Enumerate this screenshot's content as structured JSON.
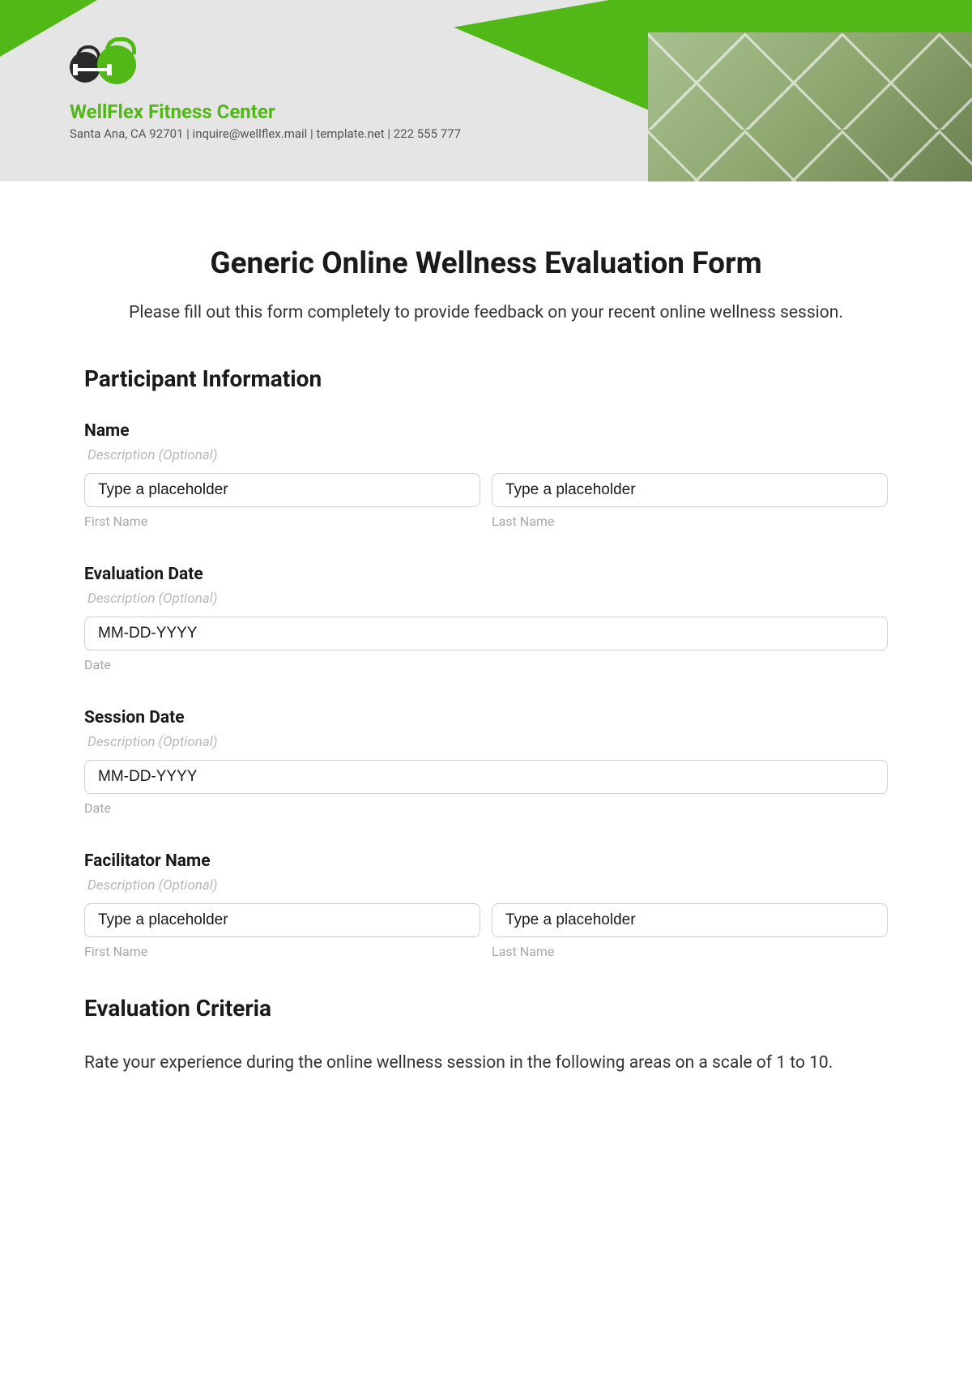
{
  "brand": {
    "name": "WellFlex Fitness Center",
    "contact": "Santa Ana, CA 92701 | inquire@wellflex.mail | template.net | 222 555 777"
  },
  "page": {
    "title": "Generic Online Wellness Evaluation Form",
    "intro": "Please fill out this form completely to provide feedback on your recent online wellness session."
  },
  "sections": {
    "participant": {
      "title": "Participant Information"
    },
    "criteria": {
      "title": "Evaluation Criteria",
      "desc": "Rate your experience during the online wellness session in the following areas on a scale of 1 to 10."
    }
  },
  "fields": {
    "name": {
      "label": "Name",
      "desc": "Description (Optional)",
      "first_ph": "Type a placeholder",
      "last_ph": "Type a placeholder",
      "first_sub": "First Name",
      "last_sub": "Last Name"
    },
    "eval_date": {
      "label": "Evaluation Date",
      "desc": "Description (Optional)",
      "ph": "MM-DD-YYYY",
      "sub": "Date"
    },
    "session_date": {
      "label": "Session Date",
      "desc": "Description (Optional)",
      "ph": "MM-DD-YYYY",
      "sub": "Date"
    },
    "facilitator": {
      "label": "Facilitator Name",
      "desc": "Description (Optional)",
      "first_ph": "Type a placeholder",
      "last_ph": "Type a placeholder",
      "first_sub": "First Name",
      "last_sub": "Last Name"
    }
  }
}
